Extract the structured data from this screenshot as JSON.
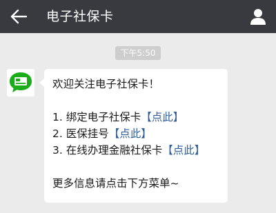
{
  "header": {
    "title": "电子社保卡",
    "back_icon": "back-arrow-icon",
    "profile_icon": "user-profile-icon"
  },
  "chat": {
    "timestamp": "下午5:50",
    "message": {
      "avatar_icon": "social-security-card-icon",
      "avatar_color": "#1aad19",
      "greeting": "欢迎关注电子社保卡！",
      "items": [
        {
          "prefix": "1. 绑定电子社保卡",
          "link": "【点此】"
        },
        {
          "prefix": "2. 医保挂号",
          "link": "【点此】"
        },
        {
          "prefix": "3. 在线办理金融社保卡",
          "link": "【点此】"
        }
      ],
      "footer": "更多信息请点击下方菜单~"
    }
  },
  "colors": {
    "header_bg": "#393a3f",
    "chat_bg": "#ebebeb",
    "link": "#2f5d9a"
  }
}
